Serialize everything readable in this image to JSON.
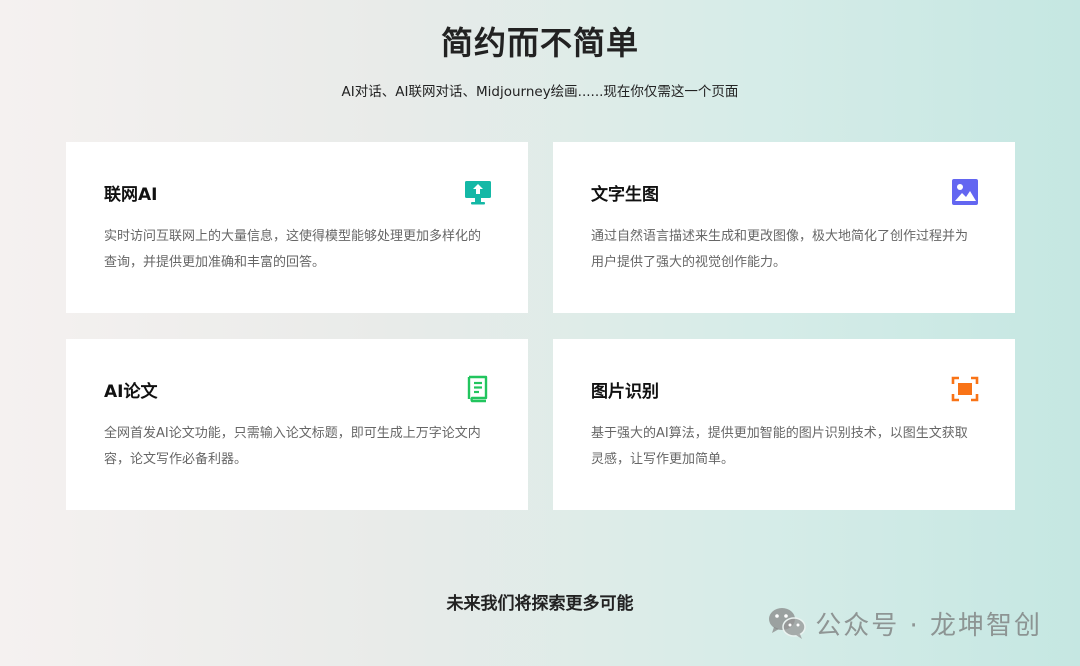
{
  "hero": {
    "title": "简约而不简单",
    "subtitle": "AI对话、AI联网对话、Midjourney绘画......现在你仅需这一个页面"
  },
  "features": [
    {
      "title": "联网AI",
      "description": "实时访问互联网上的大量信息，这使得模型能够处理更加多样化的查询，并提供更加准确和丰富的回答。",
      "icon": "monitor-upload-icon",
      "icon_color": "#14b8a6"
    },
    {
      "title": "文字生图",
      "description": "通过自然语言描述来生成和更改图像，极大地简化了创作过程并为用户提供了强大的视觉创作能力。",
      "icon": "image-icon",
      "icon_color": "#6366f1"
    },
    {
      "title": "AI论文",
      "description": "全网首发AI论文功能，只需输入论文标题，即可生成上万字论文内容，论文写作必备利器。",
      "icon": "document-icon",
      "icon_color": "#22c55e"
    },
    {
      "title": "图片识别",
      "description": "基于强大的AI算法，提供更加智能的图片识别技术，以图生文获取灵感，让写作更加简单。",
      "icon": "scan-frame-icon",
      "icon_color": "#f97316"
    }
  ],
  "footer": {
    "slogan": "未来我们将探索更多可能"
  },
  "watermark": {
    "text": "公众号 · 龙坤智创"
  }
}
